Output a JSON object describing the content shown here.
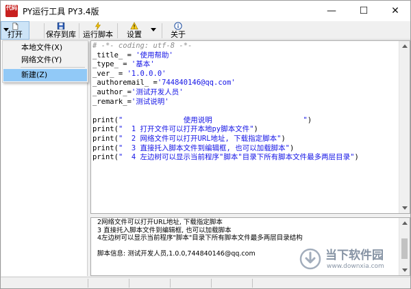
{
  "window": {
    "title": "PY运行工具 PY3.4版",
    "app_icon_glyph": "代码",
    "min_glyph": "—",
    "max_glyph": "☐",
    "close_glyph": "✕"
  },
  "toolbar": {
    "open_label": "打开",
    "save_label": "保存到库",
    "run_label": "运行脚本",
    "settings_label": "设置",
    "about_label": "关于"
  },
  "open_menu": {
    "items": [
      {
        "label": "本地文件(X)"
      },
      {
        "label": "网络文件(Y)"
      },
      {
        "label": "新建(Z)",
        "selected": true
      }
    ]
  },
  "editor": {
    "lines": [
      {
        "kind": "comment",
        "text": "# -*- coding: utf-8 -*-"
      },
      {
        "code": "_title_ = ",
        "str": "'使用帮助'"
      },
      {
        "code": "_type_ = ",
        "str": "'基本'"
      },
      {
        "code": "_ver_ = ",
        "str": "'1.0.0.0'"
      },
      {
        "code": "_authoremail_ =",
        "str": "'744840146@qq.com'"
      },
      {
        "code": "_author_=",
        "str": "'测试开发人员'"
      },
      {
        "code": "_remark_=",
        "str": "'测试说明'"
      },
      {
        "code": "",
        "str": ""
      },
      {
        "code": "print(",
        "str": "\"              使用说明                     \"",
        "tail": ")"
      },
      {
        "code": "print(",
        "str": "\"  1 打开文件可以打开本地py脚本文件\"",
        "tail": ")"
      },
      {
        "code": "print(",
        "str": "\"  2 网络文件可以打开URL地址, 下载指定脚本\"",
        "tail": ")"
      },
      {
        "code": "print(",
        "str": "\"  3 直接托入脚本文件到编辑框, 也可以加载脚本\"",
        "tail": ")"
      },
      {
        "code": "print(",
        "str": "\"  4 左边树可以显示当前程序\"脚本\"目录下所有脚本文件最多两层目录\"",
        "tail": ")"
      }
    ]
  },
  "output": {
    "lines": [
      "2网络文件可以打开URL地址, 下载指定脚本",
      "3 直接托入脚本文件到编辑框, 也可以加载脚本",
      "4左边树可以显示当前程序\"脚本\"目录下所有脚本文件最多两层目录结构",
      "",
      "脚本信息: 测试开发人员,1.0.0,744840146@qq.com"
    ]
  },
  "watermark": {
    "text": "当下软件园",
    "url": "www.downxia.com"
  },
  "colors": {
    "string": "#1414e6",
    "comment": "#8c8c8c",
    "menu_highlight": "#91c9f7",
    "toolbar_pressed": "#cde4f7"
  }
}
